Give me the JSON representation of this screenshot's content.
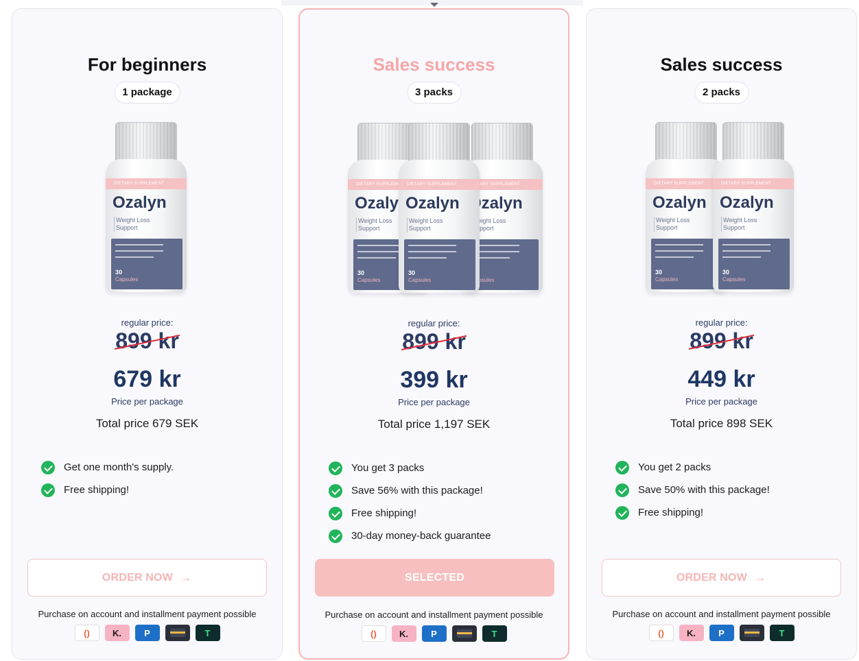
{
  "cards": [
    {
      "title": "For beginners",
      "package_label": "1 package",
      "brand": "Ozalyn",
      "bottle_strip": "DIETARY SUPPLEMENT",
      "bottle_sub": "Weight Loss\nSupport",
      "bottle_count": "30",
      "bottle_caps": "Capsules",
      "regular_label": "regular price:",
      "old_price": "899 kr",
      "price": "679 kr",
      "per_label": "Price per package",
      "total": "Total price 679 SEK",
      "features": [
        "Get one month's supply.",
        "Free shipping!"
      ],
      "button": "ORDER NOW",
      "note": "Purchase on account and installment payment possible"
    },
    {
      "title": "Sales success",
      "package_label": "3 packs",
      "brand": "Ozalyn",
      "bottle_strip": "DIETARY SUPPLEMENT",
      "bottle_sub": "Weight Loss\nSupport",
      "bottle_count": "30",
      "bottle_caps": "Capsules",
      "regular_label": "regular price:",
      "old_price": "899 kr",
      "price": "399 kr",
      "per_label": "Price per package",
      "total": "Total price 1,197 SEK",
      "features": [
        "You get 3 packs",
        "Save 56% with this package!",
        "Free shipping!",
        "30-day money-back guarantee"
      ],
      "button": "SELECTED",
      "note": "Purchase on account and installment payment possible"
    },
    {
      "title": "Sales success",
      "package_label": "2 packs",
      "brand": "Ozalyn",
      "bottle_strip": "DIETARY SUPPLEMENT",
      "bottle_sub": "Weight Loss\nSupport",
      "bottle_count": "30",
      "bottle_caps": "Capsules",
      "regular_label": "regular price:",
      "old_price": "899 kr",
      "price": "449 kr",
      "per_label": "Price per package",
      "total": "Total price 898 SEK",
      "features": [
        "You get 2 packs",
        "Save 50% with this package!",
        "Free shipping!"
      ],
      "button": "ORDER NOW",
      "note": "Purchase on account and installment payment possible"
    }
  ],
  "payment_icons": [
    {
      "name": "swish-icon",
      "glyph": "()"
    },
    {
      "name": "klarna-icon",
      "glyph": "K."
    },
    {
      "name": "paypal-icon",
      "glyph": "P"
    },
    {
      "name": "card-icon",
      "glyph": ""
    },
    {
      "name": "trustly-icon",
      "glyph": "T"
    }
  ],
  "colors": {
    "accent_pink": "#f7bfbf",
    "title_highlight": "#f4a7a7",
    "price_navy": "#1f3663",
    "check_green": "#22b45a",
    "strike_red": "#e02d3c"
  }
}
